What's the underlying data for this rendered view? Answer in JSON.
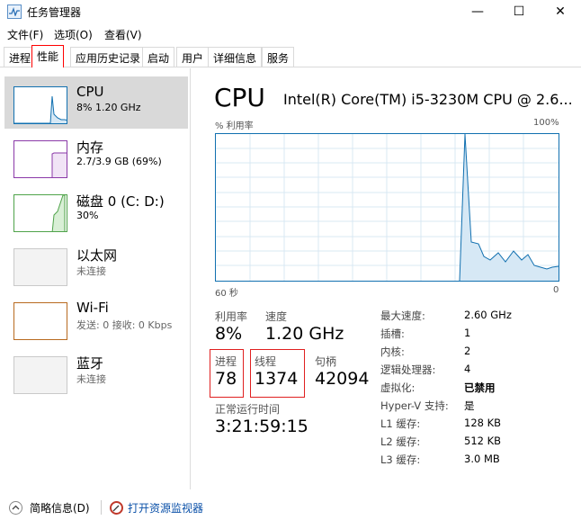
{
  "window": {
    "title": "任务管理器",
    "controls": {
      "minimize": "—",
      "maximize": "☐",
      "close": "✕"
    }
  },
  "menu": [
    "文件(F)",
    "选项(O)",
    "查看(V)"
  ],
  "tabs": [
    "进程",
    "性能",
    "应用历史记录",
    "启动",
    "用户",
    "详细信息",
    "服务"
  ],
  "sidebar": {
    "items": [
      {
        "title": "CPU",
        "subtitle": "8% 1.20 GHz",
        "color": "#1170b0"
      },
      {
        "title": "内存",
        "subtitle": "2.7/3.9 GB (69%)",
        "color": "#8b3aa8"
      },
      {
        "title": "磁盘 0 (C: D:)",
        "subtitle": "30%",
        "color": "#4fa34a"
      },
      {
        "title": "以太网",
        "subtitle": "未连接",
        "color": "#999999"
      },
      {
        "title": "Wi-Fi",
        "subtitle": "发送: 0 接收: 0 Kbps",
        "color": "#b86a1f"
      },
      {
        "title": "蓝牙",
        "subtitle": "未连接",
        "color": "#999999"
      }
    ]
  },
  "main": {
    "title": "CPU",
    "model": "Intel(R) Core(TM) i5-3230M CPU @ 2.6...",
    "graph": {
      "y_label": "% 利用率",
      "y_max": "100%",
      "x_left": "60 秒",
      "x_right": "0",
      "line_color": "#1170b0",
      "fill_color": "#d6e8f5"
    },
    "stats": {
      "util_label": "利用率",
      "util_value": "8%",
      "speed_label": "速度",
      "speed_value": "1.20 GHz",
      "proc_label": "进程",
      "proc_value": "78",
      "thread_label": "线程",
      "thread_value": "1374",
      "handle_label": "句柄",
      "handle_value": "42094",
      "uptime_label": "正常运行时间",
      "uptime_value": "3:21:59:15"
    },
    "specs": [
      {
        "label": "最大速度:",
        "value": "2.60 GHz"
      },
      {
        "label": "插槽:",
        "value": "1"
      },
      {
        "label": "内核:",
        "value": "2"
      },
      {
        "label": "逻辑处理器:",
        "value": "4"
      },
      {
        "label": "虚拟化:",
        "value": "已禁用",
        "bold": true
      },
      {
        "label": "Hyper-V 支持:",
        "value": "是"
      },
      {
        "label": "L1 缓存:",
        "value": "128 KB"
      },
      {
        "label": "L2 缓存:",
        "value": "512 KB"
      },
      {
        "label": "L3 缓存:",
        "value": "3.0 MB"
      }
    ]
  },
  "footer": {
    "summary_label": "简略信息(D)",
    "monitor_label": "打开资源监视器"
  }
}
